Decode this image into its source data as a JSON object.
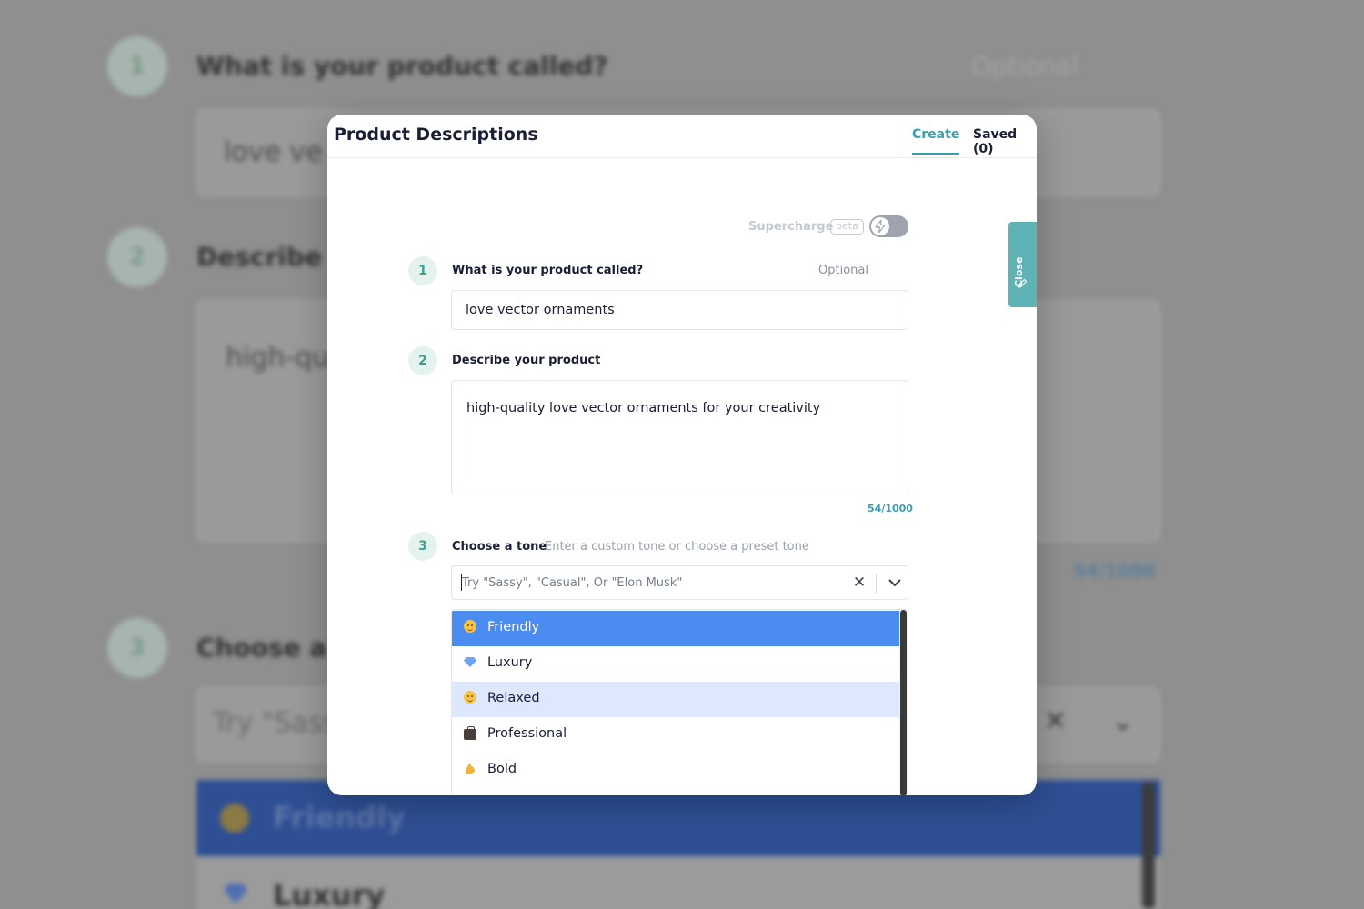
{
  "background": {
    "steps": [
      "1",
      "2",
      "3"
    ],
    "q1": "What is your product called?",
    "q1_optional": "Optional",
    "q1_value": "love ve",
    "q2": "Describe y",
    "q2_value": "high-qu",
    "count": "54/1000",
    "q3": "Choose a t",
    "tone_placeholder": "Try \"Sass",
    "option1": "Friendly",
    "option2": "Luxury"
  },
  "modal": {
    "title": "Product Descriptions",
    "tabs": {
      "create": "Create",
      "saved": "Saved (0)"
    },
    "supercharge": {
      "label": "Supercharge",
      "badge": "beta",
      "enabled": false
    },
    "steps": [
      {
        "num": "1",
        "label": "What is your product called?",
        "optional": "Optional",
        "value": "love vector ornaments"
      },
      {
        "num": "2",
        "label": "Describe your product",
        "value": "high-quality love vector ornaments for your creativity",
        "counter": "54/1000"
      },
      {
        "num": "3",
        "label": "Choose a tone",
        "hint": "Enter a custom tone or choose a preset tone",
        "placeholder": "Try \"Sassy\", \"Casual\", Or \"Elon Musk\""
      }
    ],
    "tone_options": [
      {
        "label": "Friendly",
        "icon": "smiley-icon",
        "state": "selected"
      },
      {
        "label": "Luxury",
        "icon": "gem-icon",
        "state": ""
      },
      {
        "label": "Relaxed",
        "icon": "relieved-face-icon",
        "state": "hovered"
      },
      {
        "label": "Professional",
        "icon": "briefcase-icon",
        "state": ""
      },
      {
        "label": "Bold",
        "icon": "flexed-arm-icon",
        "state": ""
      }
    ],
    "colors": {
      "accent": "#3a9eb0",
      "selected": "#4b8cf0",
      "hover": "#dde8fd",
      "step": "#e4f3ee"
    }
  },
  "side_tab": {
    "label": "Close"
  }
}
